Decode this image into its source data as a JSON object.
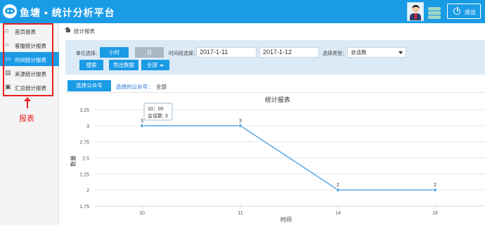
{
  "app": {
    "title": "鱼塘 • 统计分析平台"
  },
  "header": {
    "logout_label": "退出"
  },
  "colors": {
    "brand": "#1a9be6",
    "filter_bg": "#dceaf6",
    "annotation": "#e8211e",
    "series": "#5aa9e6"
  },
  "sidebar": {
    "items": [
      {
        "label": "首页报表",
        "icon": "home-icon",
        "active": false
      },
      {
        "label": "客服统计报表",
        "icon": "headset-icon",
        "active": false
      },
      {
        "label": "时间统计报表",
        "icon": "monitor-icon",
        "active": true
      },
      {
        "label": "来源统计报表",
        "icon": "chart-icon",
        "active": false
      },
      {
        "label": "汇总统计报表",
        "icon": "clipboard-icon",
        "active": false
      }
    ],
    "annotation_label": "报表"
  },
  "breadcrumb": {
    "text": "统计报表"
  },
  "filters": {
    "unit_label": "单位选择：",
    "unit_hour": "小时",
    "unit_day": "日",
    "range_label": "时间段选择：",
    "start_date": "2017-1-11",
    "end_date": "2017-1-12",
    "type_label": "选择类型：",
    "type_value": "会话数",
    "search_button": "搜索",
    "export_button": "导出数据",
    "all_button": "全部"
  },
  "account": {
    "select_button": "选择公众号",
    "selected_label": "选择的公众号：",
    "selected_value": "全部"
  },
  "chart_data": {
    "type": "line",
    "title": "统计报表",
    "xlabel": "时间",
    "ylabel": "数量",
    "categories": [
      "10",
      "11",
      "14",
      "18"
    ],
    "values": [
      3,
      3,
      2,
      2
    ],
    "ylim": [
      1.75,
      3.25
    ],
    "yticks": [
      "3.25",
      "3",
      "2.75",
      "2.5",
      "2.25",
      "2",
      "1.75"
    ],
    "grid": true,
    "tooltip": {
      "title": "10：00",
      "text": "会话数: 3"
    }
  }
}
